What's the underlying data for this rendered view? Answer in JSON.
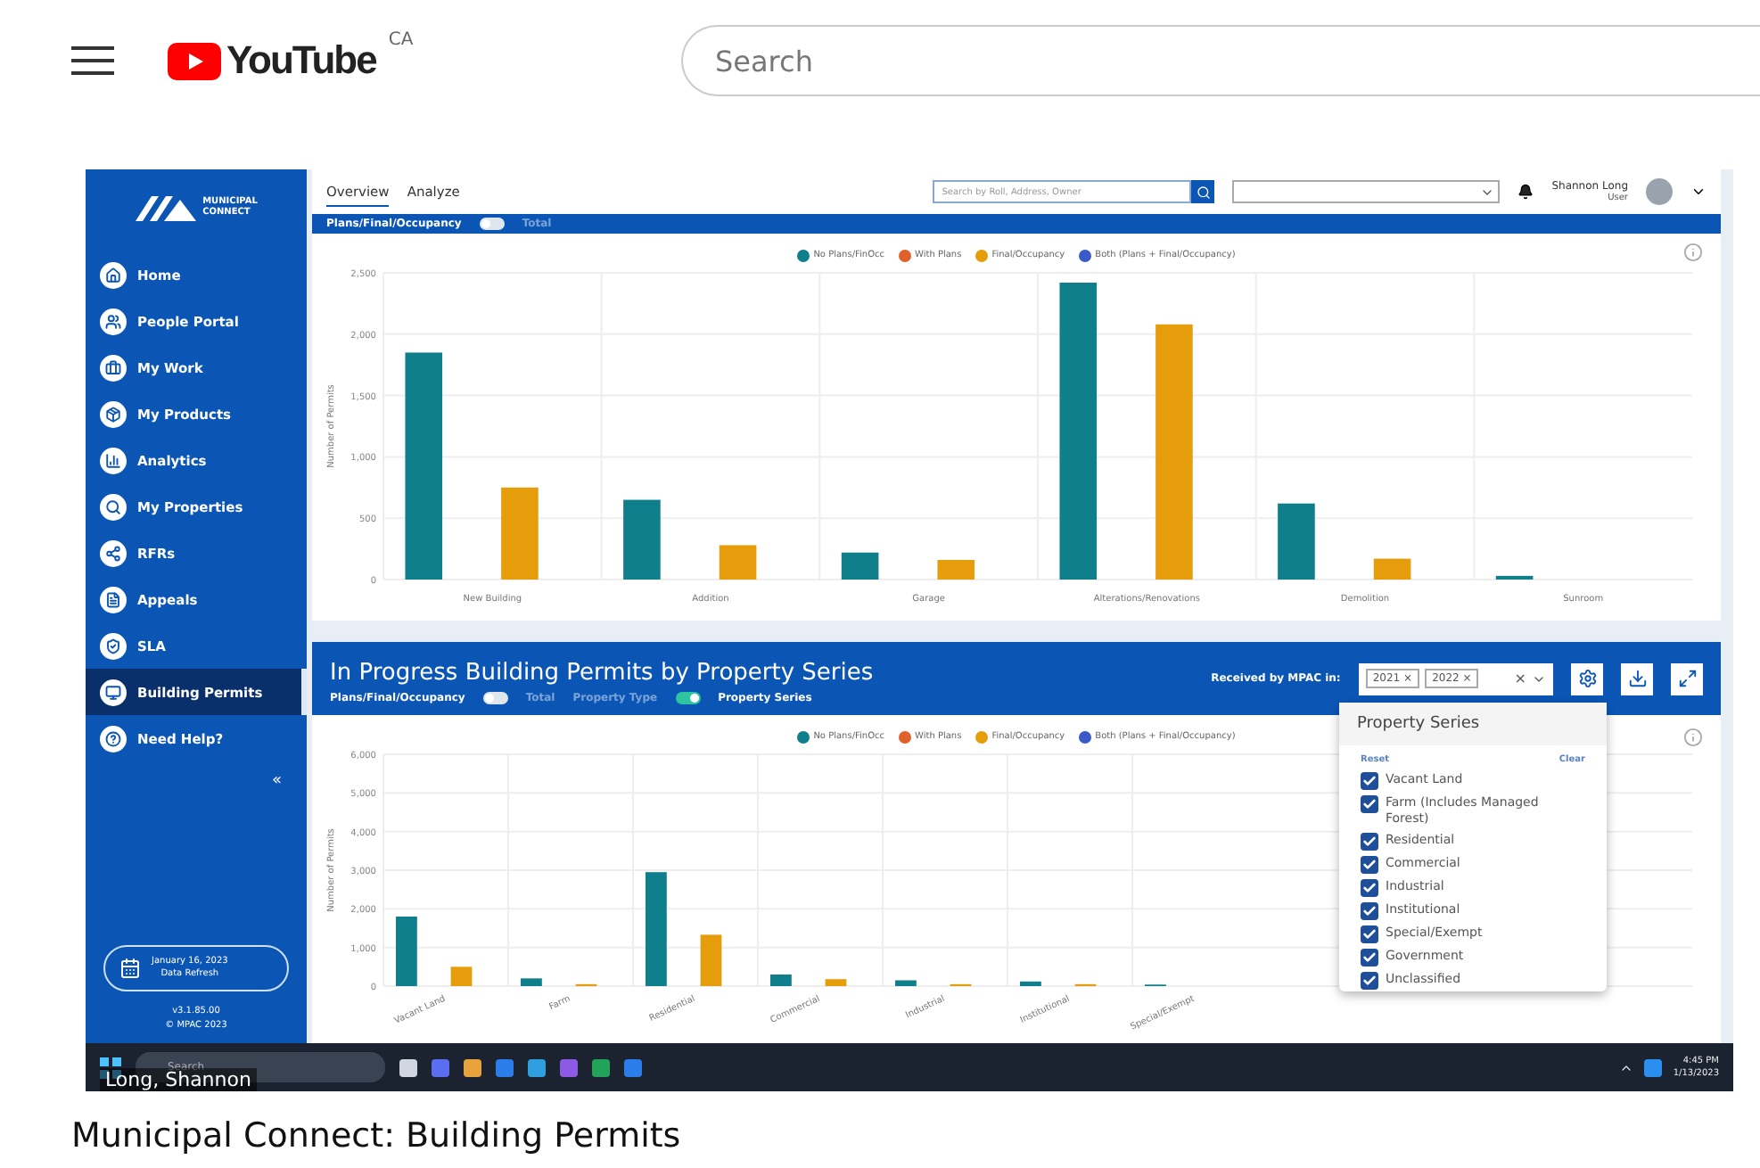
{
  "youtube": {
    "logo_text": "YouTube",
    "region": "CA",
    "search_placeholder": "Search"
  },
  "app": {
    "logo": {
      "line1": "MUNICIPAL",
      "line2": "CONNECT"
    },
    "sidebar": {
      "items": [
        {
          "label": "Home",
          "selected": false
        },
        {
          "label": "People Portal",
          "selected": false
        },
        {
          "label": "My Work",
          "selected": false
        },
        {
          "label": "My Products",
          "selected": false
        },
        {
          "label": "Analytics",
          "selected": false
        },
        {
          "label": "My Properties",
          "selected": false
        },
        {
          "label": "RFRs",
          "selected": false
        },
        {
          "label": "Appeals",
          "selected": false
        },
        {
          "label": "SLA",
          "selected": false
        },
        {
          "label": "Building Permits",
          "selected": true
        },
        {
          "label": "Need Help?",
          "selected": false
        }
      ],
      "collapse": "«",
      "refresh": {
        "date": "January 16, 2023",
        "note": "Data Refresh"
      },
      "version": "v3.1.85.00",
      "copyright": "© MPAC 2023"
    },
    "topbar": {
      "tabs": [
        {
          "label": "Overview",
          "selected": true
        },
        {
          "label": "Analyze",
          "selected": false
        }
      ],
      "search_placeholder": "Search by Roll, Address, Owner",
      "user_name": "Shannon Long",
      "user_role": "User"
    },
    "panel_top": {
      "toggles": [
        {
          "left": "Plans/Final/Occupancy",
          "right": "Total",
          "on": false
        }
      ],
      "chart_data": {
        "type": "bar",
        "grid": true,
        "legend": "top",
        "ylabel": "Number of Permits",
        "categories": [
          "New Building",
          "Addition",
          "Garage",
          "Alterations/Renovations",
          "Demolition",
          "Sunroom"
        ],
        "series": [
          {
            "name": "No Plans/FinOcc",
            "color": "#0f7f8c",
            "values": [
              1850,
              650,
              220,
              2420,
              620,
              30
            ]
          },
          {
            "name": "With Plans",
            "color": "#e0622a",
            "values": [
              null,
              null,
              null,
              null,
              null,
              null
            ]
          },
          {
            "name": "Final/Occupancy",
            "color": "#e69d0b",
            "values": [
              750,
              280,
              160,
              2080,
              170,
              null
            ]
          },
          {
            "name": "Both (Plans + Final/Occupancy)",
            "color": "#3a5bc7",
            "values": [
              null,
              null,
              null,
              null,
              null,
              null
            ]
          }
        ],
        "ylim": [
          0,
          2500
        ],
        "yticks": [
          0,
          {
            "value": 500,
            "label": "500"
          },
          {
            "value": 1000,
            "label": "1,000"
          },
          {
            "value": 1500,
            "label": "1,500"
          },
          {
            "value": 2000,
            "label": "2,000"
          },
          {
            "value": 2500,
            "label": "2,500"
          }
        ]
      }
    },
    "panel_bottom": {
      "title": "In Progress Building Permits by Property Series",
      "toggles": [
        {
          "left": "Plans/Final/Occupancy",
          "right": "Total",
          "on": false
        },
        {
          "left": "Property Type",
          "right": "Property Series",
          "on": true
        }
      ],
      "received_label": "Received by MPAC in:",
      "chips": [
        {
          "label": "2021",
          "remove": "×"
        },
        {
          "label": "2022",
          "remove": "×"
        }
      ],
      "clear": "×",
      "chart_data": {
        "type": "bar",
        "grid": true,
        "legend": "top",
        "ylabel": "Number of Permits",
        "categories": [
          "Vacant Land",
          "Farm",
          "Residential",
          "Commercial",
          "Industrial",
          "Institutional",
          "Special/Exempt"
        ],
        "series": [
          {
            "name": "No Plans/FinOcc",
            "color": "#0f7f8c",
            "values": [
              1800,
              200,
              2950,
              300,
              150,
              120,
              40
            ]
          },
          {
            "name": "With Plans",
            "color": "#e0622a",
            "values": [
              null,
              null,
              null,
              null,
              null,
              null,
              null
            ]
          },
          {
            "name": "Final/Occupancy",
            "color": "#e69d0b",
            "values": [
              500,
              50,
              1330,
              180,
              50,
              50,
              null
            ]
          },
          {
            "name": "Both (Plans + Final/Occupancy)",
            "color": "#3a5bc7",
            "values": [
              null,
              null,
              null,
              null,
              null,
              null,
              null
            ]
          }
        ],
        "ylim": [
          0,
          6000
        ],
        "yticks": [
          0,
          {
            "value": 1000,
            "label": "1,000"
          },
          {
            "value": 2000,
            "label": "2,000"
          },
          {
            "value": 3000,
            "label": "3,000"
          },
          {
            "value": 4000,
            "label": "4,000"
          },
          {
            "value": 5000,
            "label": "5,000"
          },
          {
            "value": 6000,
            "label": "6,000"
          }
        ]
      },
      "dropdown": {
        "title": "Property Series",
        "reset": "Reset",
        "clear": "Clear",
        "options": [
          {
            "label": "Vacant Land",
            "checked": true
          },
          {
            "label": "Farm (Includes Managed Forest)",
            "checked": true
          },
          {
            "label": "Residential",
            "checked": true
          },
          {
            "label": "Commercial",
            "checked": true
          },
          {
            "label": "Industrial",
            "checked": true
          },
          {
            "label": "Institutional",
            "checked": true
          },
          {
            "label": "Special/Exempt",
            "checked": true
          },
          {
            "label": "Government",
            "checked": true
          },
          {
            "label": "Unclassified",
            "checked": true
          }
        ]
      }
    }
  },
  "taskbar": {
    "search_placeholder": "Search",
    "time": "4:45 PM",
    "date": "1/13/2023"
  },
  "caption": "Long, Shannon",
  "video_title": "Municipal Connect: Building Permits"
}
